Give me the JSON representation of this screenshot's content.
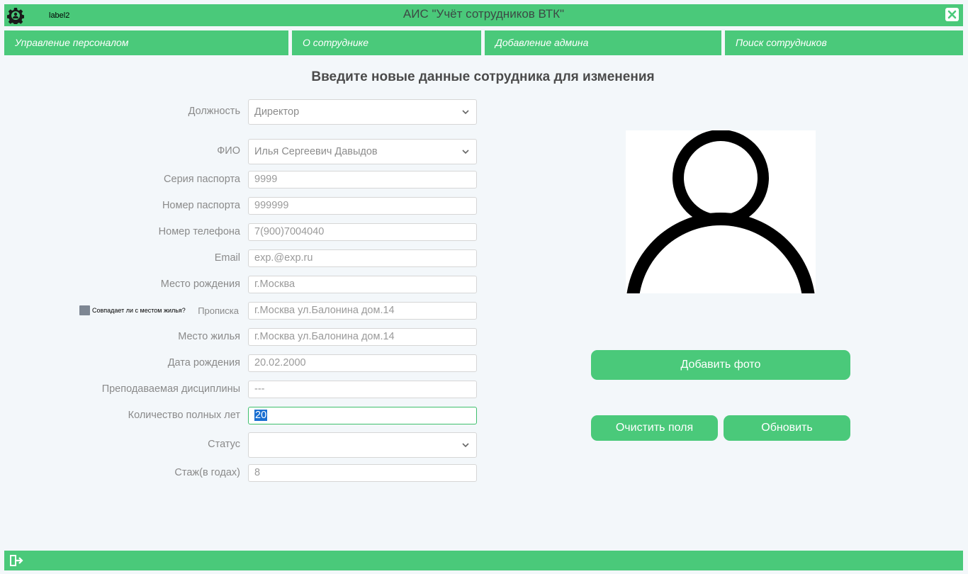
{
  "window": {
    "label2": "label2",
    "title": "АИС \"Учёт сотрудников ВТК\""
  },
  "icons": {
    "app": "gear-icon",
    "close": "close-icon",
    "exit": "exit-icon",
    "dropdown": "chevron-down-icon",
    "photo": "user-silhouette-icon"
  },
  "menu": [
    {
      "label": "Управление персоналом"
    },
    {
      "label": "О сотруднике"
    },
    {
      "label": "Добавление админа"
    },
    {
      "label": "Поиск сотрудников"
    }
  ],
  "form": {
    "heading": "Введите новые данные сотрудника для изменения",
    "position": {
      "label": "Должность",
      "value": "Директор"
    },
    "fio": {
      "label": "ФИО",
      "value": "Илья Сергеевич Давыдов"
    },
    "passport_series": {
      "label": "Серия паспорта",
      "value": "9999"
    },
    "passport_number": {
      "label": "Номер паспорта",
      "value": "999999"
    },
    "phone": {
      "label": "Номер телефона",
      "value": "7(900)7004040"
    },
    "email": {
      "label": "Email",
      "value": "exp.@exp.ru"
    },
    "birthplace": {
      "label": "Место рождения",
      "value": "г.Москва"
    },
    "same_as_residence": {
      "label": "Совпадает ли с местом жилья?",
      "checked": false
    },
    "registration": {
      "label": "Прописка",
      "value": "г.Москва ул.Балонина дом.14"
    },
    "residence": {
      "label": "Место жилья",
      "value": "г.Москва ул.Балонина дом.14"
    },
    "birthdate": {
      "label": "Дата рождения",
      "value": "20.02.2000"
    },
    "discipline": {
      "label": "Преподаваемая дисциплины",
      "value": "---"
    },
    "full_years": {
      "label": "Количество полных лет",
      "value": "20"
    },
    "status": {
      "label": "Статус",
      "value": ""
    },
    "experience": {
      "label": "Стаж(в годах)",
      "value": "8"
    }
  },
  "buttons": {
    "add_photo": "Добавить фото",
    "clear": "Очистить поля",
    "update": "Обновить"
  },
  "colors": {
    "accent": "#4ac97a",
    "background": "#f3f7fa",
    "selection": "#1b6fd1"
  }
}
